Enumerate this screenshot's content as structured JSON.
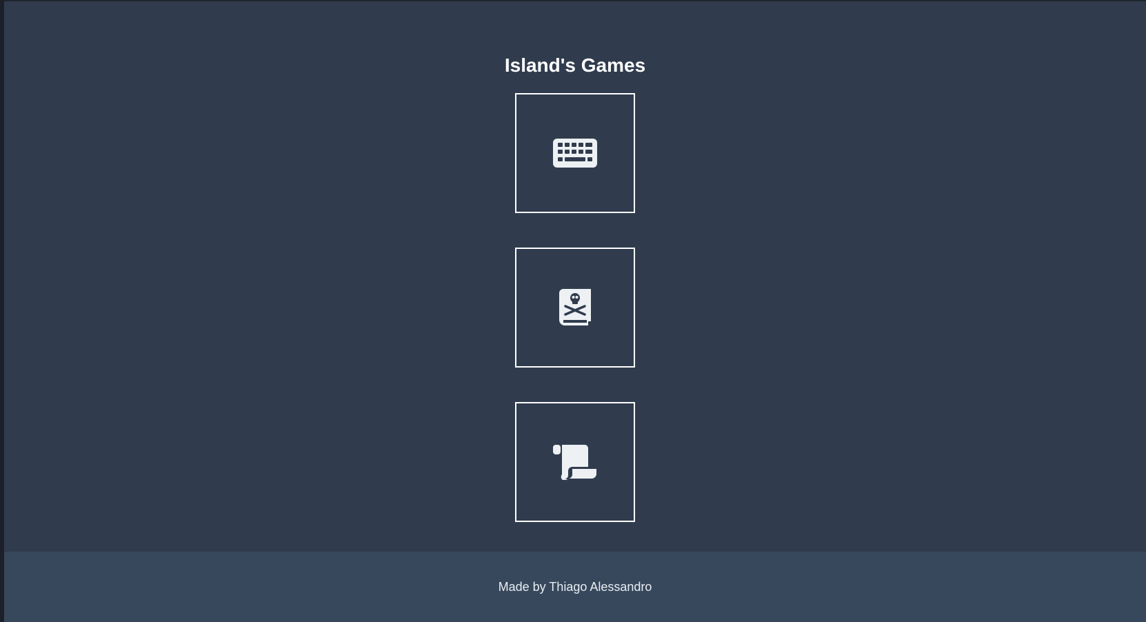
{
  "header": {
    "title": "Island's Games"
  },
  "games": [
    {
      "icon": "keyboard-icon"
    },
    {
      "icon": "skull-crossbones-book-icon"
    },
    {
      "icon": "scroll-icon"
    }
  ],
  "footer": {
    "credit": "Made by Thiago Alessandro"
  },
  "colors": {
    "background": "#303c4e",
    "footer_background": "#37485c",
    "foreground": "#ffffff",
    "icon": "#eef1f3"
  }
}
